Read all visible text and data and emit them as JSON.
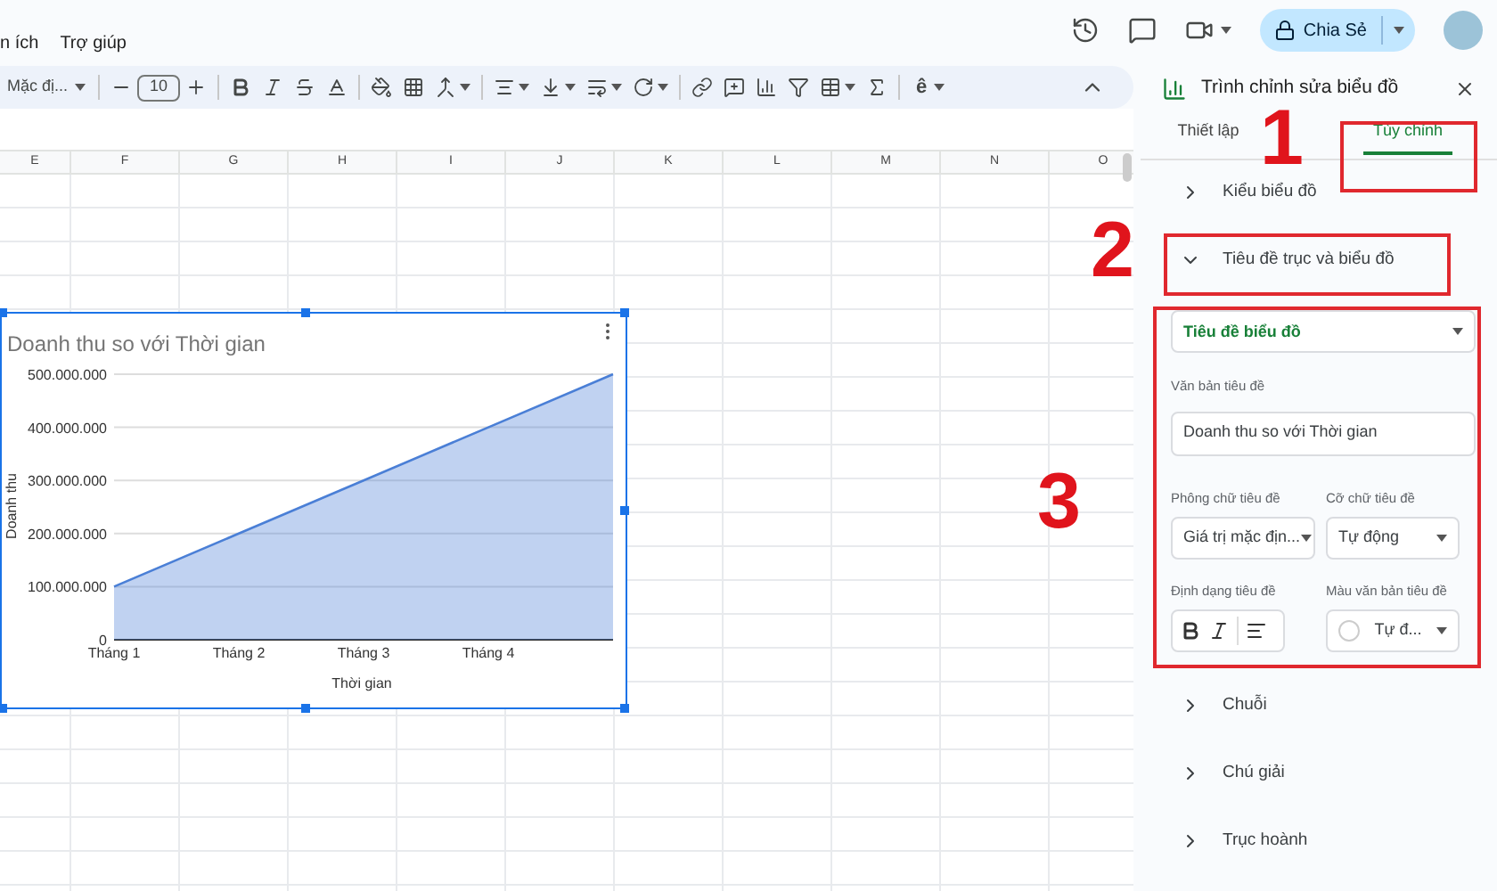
{
  "menu": [
    "n ích",
    "Trợ giúp"
  ],
  "header": {
    "share_label": "Chia Sẻ"
  },
  "toolbar": {
    "font": "Mặc đị...",
    "font_size": "10",
    "input_tool": "ê"
  },
  "grid": {
    "columns": [
      "E",
      "F",
      "G",
      "H",
      "I",
      "J",
      "K",
      "L",
      "M",
      "N",
      "O"
    ]
  },
  "chart": {
    "chart_data": {
      "type": "area",
      "title": "Doanh thu so với Thời gian",
      "xlabel": "Thời gian",
      "ylabel": "Doanh thu",
      "grid": true,
      "categories": [
        "Tháng 1",
        "Tháng 2",
        "Tháng 3",
        "Tháng 4",
        null
      ],
      "ylim": [
        0,
        500000000
      ],
      "yticks": [
        {
          "value": 0,
          "label": "0"
        },
        {
          "value": 100000000,
          "label": "100.000.000"
        },
        {
          "value": 200000000,
          "label": "200.000.000"
        },
        {
          "value": 300000000,
          "label": "300.000.000"
        },
        {
          "value": 400000000,
          "label": "400.000.000"
        },
        {
          "value": 500000000,
          "label": "500.000.000"
        }
      ],
      "series": [
        {
          "color": "#4a7fd6",
          "values": [
            100000000,
            200000000,
            300000000,
            400000000,
            500000000
          ]
        }
      ]
    }
  },
  "editor": {
    "title": "Trình chỉnh sửa biểu đồ",
    "tabs": [
      {
        "label": "Thiết lập",
        "selected": false
      },
      {
        "label": "Tùy chỉnh",
        "selected": true
      }
    ],
    "sections": [
      {
        "label": "Kiểu biểu đồ",
        "expanded": false
      },
      {
        "label": "Tiêu đề trục và biểu đồ",
        "expanded": true
      },
      {
        "label": "Chuỗi",
        "expanded": false
      },
      {
        "label": "Chú giải",
        "expanded": false
      },
      {
        "label": "Trục hoành",
        "expanded": false
      }
    ],
    "title_settings": {
      "target": "Tiêu đề biểu đồ",
      "text_label": "Văn bản tiêu đề",
      "text_value": "Doanh thu so với Thời gian",
      "font_label": "Phông chữ tiêu đề",
      "font_value": "Giá trị mặc địn...",
      "size_label": "Cỡ chữ tiêu đề",
      "size_value": "Tự động",
      "format_label": "Định dạng tiêu đề",
      "color_label": "Màu văn bản tiêu đề",
      "color_value": "Tự đ..."
    }
  },
  "annotations": [
    {
      "label": "1"
    },
    {
      "label": "2"
    },
    {
      "label": "3"
    }
  ]
}
